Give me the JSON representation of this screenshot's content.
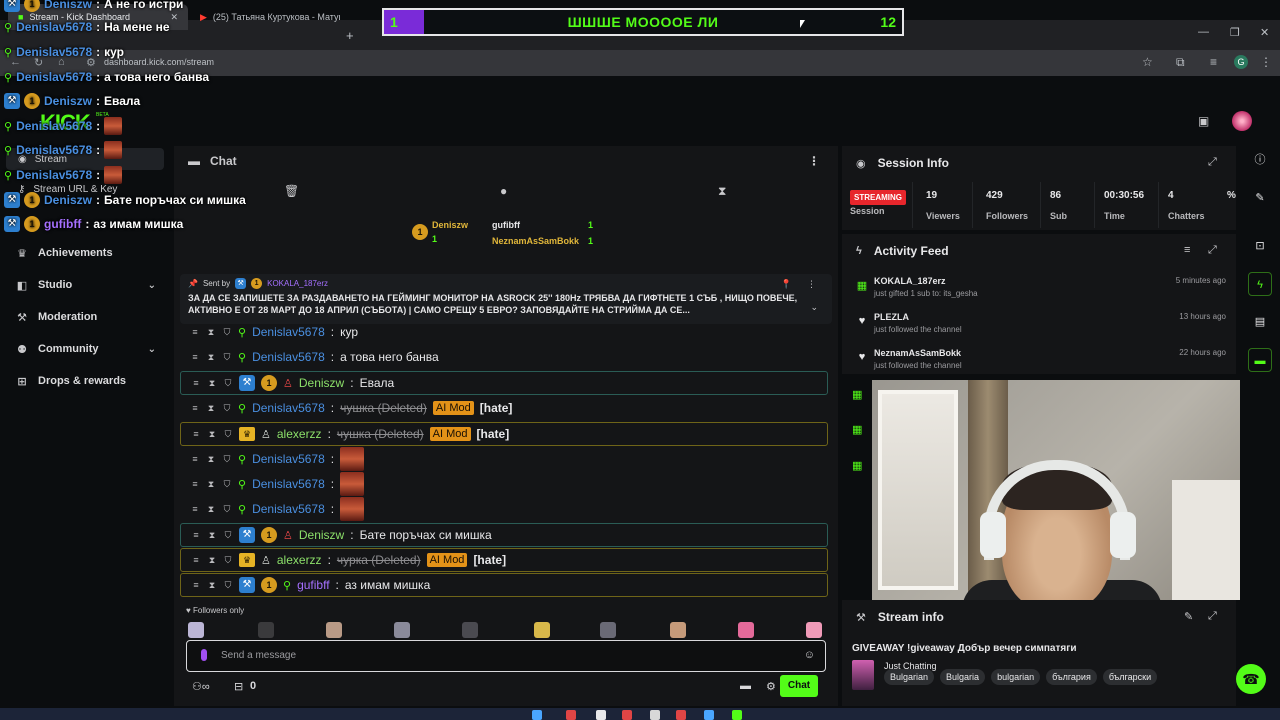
{
  "browser": {
    "tabs": [
      {
        "label": "Stream - Kick Dashboard"
      },
      {
        "label": "(25) Татьяна Куртукова - Матушка"
      }
    ],
    "url": "dashboard.kick.com/stream"
  },
  "app": {
    "logo": "KICK",
    "logo_sup": "BETA"
  },
  "sidebar": {
    "sub_items": [
      {
        "label": "Stream",
        "icon": "broadcast-icon"
      },
      {
        "label": "Stream URL & Key",
        "icon": "key-icon"
      }
    ],
    "items": [
      {
        "label": "Achievements",
        "icon": "trophy-icon"
      },
      {
        "label": "Studio",
        "icon": "palette-icon"
      },
      {
        "label": "Moderation",
        "icon": "wrench-icon"
      },
      {
        "label": "Community",
        "icon": "people-icon"
      },
      {
        "label": "Drops & rewards",
        "icon": "gift-icon"
      }
    ]
  },
  "chat": {
    "title": "Chat",
    "top_gifters": [
      {
        "name": "Deniszw",
        "count": "1"
      },
      {
        "name": "gufibff",
        "count": "1"
      },
      {
        "name": "NeznamAsSamBokk",
        "count": "1"
      }
    ],
    "pinned": {
      "sent_by_label": "Sent by",
      "author": "KOKALA_187erz",
      "text": "ЗА ДА СЕ ЗАПИШЕТЕ ЗА РАЗДАВАНЕТО НА ГЕЙМИНГ МОНИТОР НА ASROCK 25'' 180Hz ТРЯБВА ДА ГИФТНЕТЕ 1 СЪБ , НИЩО ПОВЕЧЕ, АКТИВНО Е ОТ 28 МАРТ ДО 18 АПРИЛ (СЪБОТА) | САМО СРЕЩУ 5 ЕВРО? ЗАПОВЯДАЙТЕ НА СТРИЙМА ДА СЕ..."
    },
    "messages": [
      {
        "user": "Denislav5678",
        "text": "кур"
      },
      {
        "user": "Denislav5678",
        "text": "а това него банва"
      },
      {
        "user": "Deniszw",
        "text": "Евала"
      },
      {
        "user": "Denislav5678",
        "deleted": "чушка (Deleted)",
        "tag": "AI Mod",
        "reason": "[hate]"
      },
      {
        "user": "alexerzz",
        "deleted": "чушка (Deleted)",
        "tag": "AI Mod",
        "reason": "[hate]"
      },
      {
        "user": "Denislav5678",
        "text": ""
      },
      {
        "user": "Denislav5678",
        "text": ""
      },
      {
        "user": "Denislav5678",
        "text": ""
      },
      {
        "user": "Deniszw",
        "text": "Бате поръчах си мишка"
      },
      {
        "user": "alexerzz",
        "deleted": "чурка (Deleted)",
        "tag": "AI Mod",
        "reason": "[hate]"
      },
      {
        "user": "gufibff",
        "text": "аз имам мишка"
      }
    ],
    "followers_only": "Followers only",
    "input_placeholder": "Send a message",
    "points": "0",
    "send_label": "Chat"
  },
  "session_info": {
    "title": "Session Info",
    "status": "STREAMING",
    "status_label": "Session",
    "stats": [
      {
        "value": "19",
        "label": "Viewers"
      },
      {
        "value": "429",
        "label": "Followers"
      },
      {
        "value": "86",
        "label": "Sub"
      },
      {
        "value": "00:30:56",
        "label": "Time"
      },
      {
        "value": "4",
        "label": "Chatters"
      },
      {
        "value": "%",
        "label": ""
      }
    ]
  },
  "activity_feed": {
    "title": "Activity Feed",
    "items": [
      {
        "name": "KOKALA_187erz",
        "desc": "just gifted 1 sub to: its_gesha",
        "time": "5 minutes ago",
        "icon": "gift-icon"
      },
      {
        "name": "PLEZLA",
        "desc": "just followed the channel",
        "time": "13 hours ago",
        "icon": "heart-icon"
      },
      {
        "name": "NeznamAsSamBokk",
        "desc": "just followed the channel",
        "time": "22 hours ago",
        "icon": "heart-icon"
      }
    ]
  },
  "stream_info": {
    "title": "Stream info",
    "stream_title": "GIVEAWAY !giveaway Добър вечер симпатяги",
    "category": "Just Chatting",
    "tags": [
      "Bulgarian",
      "Bulgaria",
      "bulgarian",
      "българия",
      "български"
    ]
  },
  "overlay": {
    "lines": [
      {
        "user": "Deniszw",
        "text": "А не го истри"
      },
      {
        "user": "Denislav5678",
        "text": "На мене не"
      },
      {
        "user": "Denislav5678",
        "text": "кур"
      },
      {
        "user": "Denislav5678",
        "text": "а това него банва"
      },
      {
        "user": "Deniszw",
        "text": "Евала"
      },
      {
        "user": "Denislav5678",
        "text": ""
      },
      {
        "user": "Denislav5678",
        "text": ""
      },
      {
        "user": "Denislav5678",
        "text": ""
      },
      {
        "user": "Deniszw",
        "text": "Бате поръчах си мишка"
      },
      {
        "user": "gufibff",
        "text": "аз имам мишка"
      }
    ],
    "poll": {
      "left_value": "1",
      "title": "ШШШЕ МОООOЕ ЛИ",
      "right_value": "12",
      "left_fraction": 0.077
    }
  },
  "colors": {
    "kick_green": "#53fc18",
    "live_red": "#e7262c",
    "ai_mod": "#e39218",
    "user_blue": "#4a8fe0",
    "user_green": "#8ce06a",
    "user_purple": "#a570ff"
  }
}
